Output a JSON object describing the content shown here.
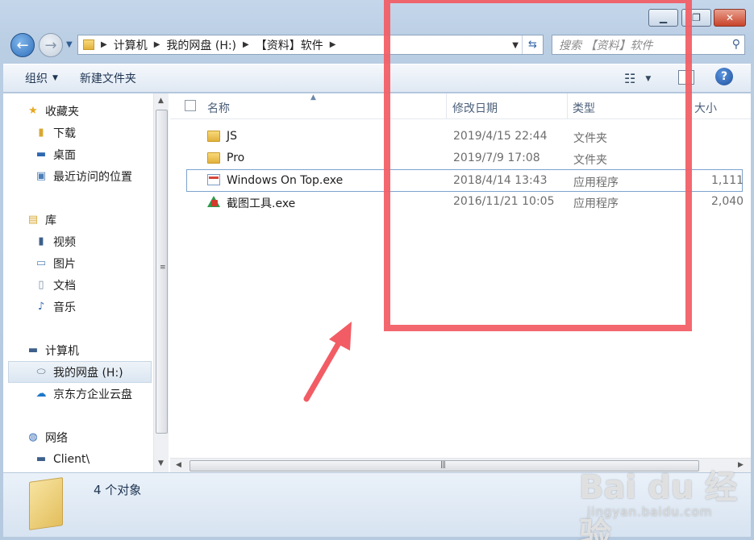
{
  "window": {
    "controls": {
      "minimize": "▁",
      "maximize": "❐",
      "close": "✕"
    }
  },
  "navigation": {
    "breadcrumb": [
      "计算机",
      "我的网盘 (H:)",
      "【资料】软件"
    ],
    "search_placeholder": "搜索 【资料】软件"
  },
  "toolbar": {
    "organize_label": "组织",
    "new_folder_label": "新建文件夹"
  },
  "sidebar": {
    "favorites": {
      "label": "收藏夹",
      "items": [
        "下载",
        "桌面",
        "最近访问的位置"
      ]
    },
    "libraries": {
      "label": "库",
      "items": [
        "视频",
        "图片",
        "文档",
        "音乐"
      ]
    },
    "computer": {
      "label": "计算机",
      "items": [
        "我的网盘 (H:)",
        "京东方企业云盘"
      ]
    },
    "network": {
      "label": "网络",
      "items": [
        "Client\\"
      ]
    }
  },
  "columns": {
    "name": "名称",
    "modified": "修改日期",
    "type": "类型",
    "size": "大小"
  },
  "files": [
    {
      "name": "JS",
      "modified": "2019/4/15 22:44",
      "type": "文件夹",
      "size": "",
      "icon": "folder-icon"
    },
    {
      "name": "Pro",
      "modified": "2019/7/9 17:08",
      "type": "文件夹",
      "size": "",
      "icon": "folder-icon"
    },
    {
      "name": "Windows On Top.exe",
      "modified": "2018/4/14 13:43",
      "type": "应用程序",
      "size": "1,111",
      "icon": "app-window-icon"
    },
    {
      "name": "截图工具.exe",
      "modified": "2016/11/21 10:05",
      "type": "应用程序",
      "size": "2,040",
      "icon": "screenshot-tool-icon"
    }
  ],
  "status": {
    "count_text": "4 个对象"
  },
  "watermark": {
    "brand": "Bai du 经验",
    "url": "jingyan.baidu.com"
  },
  "annotation_color": "#f25c64"
}
